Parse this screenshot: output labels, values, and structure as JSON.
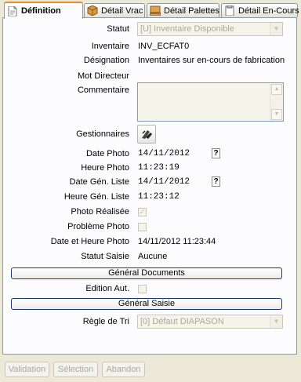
{
  "tabs": [
    {
      "label": "Définition",
      "icon": "document-icon",
      "active": true
    },
    {
      "label": "Détail Vrac",
      "icon": "box-icon"
    },
    {
      "label": "Détail Palettes",
      "icon": "pallet-icon"
    },
    {
      "label": "Détail En-Cours",
      "icon": "clipboard-icon"
    }
  ],
  "form": {
    "statut": {
      "label": "Statut",
      "value": "[U] Inventaire Disponible"
    },
    "inventaire": {
      "label": "Inventaire",
      "value": "INV_ECFAT0"
    },
    "designation": {
      "label": "Désignation",
      "value": "Inventaires sur en-cours de fabrication"
    },
    "mot_directeur": {
      "label": "Mot Directeur",
      "value": ""
    },
    "commentaire": {
      "label": "Commentaire",
      "value": ""
    },
    "gestionnaires": {
      "label": "Gestionnaires"
    },
    "date_photo": {
      "label": "Date Photo",
      "value": "14/11/2012",
      "help": "?"
    },
    "heure_photo": {
      "label": "Heure Photo",
      "value": "11:23:19"
    },
    "date_gen_liste": {
      "label": "Date Gén. Liste",
      "value": "14/11/2012",
      "help": "?"
    },
    "heure_gen_liste": {
      "label": "Heure Gén. Liste",
      "value": "11:23:12"
    },
    "photo_realisee": {
      "label": "Photo Réalisée",
      "checked": true
    },
    "probleme_photo": {
      "label": "Problème Photo",
      "checked": false
    },
    "date_heure_photo": {
      "label": "Date et Heure Photo",
      "value": "14/11/2012 11:23:44"
    },
    "statut_saisie": {
      "label": "Statut Saisie",
      "value": "Aucune"
    },
    "general_documents": "Général Documents",
    "edition_aut": {
      "label": "Edition Aut.",
      "checked": false
    },
    "general_saisie": "Général Saisie",
    "regle_de_tri": {
      "label": "Règle de Tri",
      "value": "[0] Défaut DIAPASON"
    }
  },
  "footer": {
    "validation": "Validation",
    "selection": "Sélection",
    "abandon": "Abandon"
  },
  "colors": {
    "active_tab_accent": "#e68b2c",
    "panel_bg": "#fcfcfe",
    "window_bg": "#ece9d8"
  }
}
